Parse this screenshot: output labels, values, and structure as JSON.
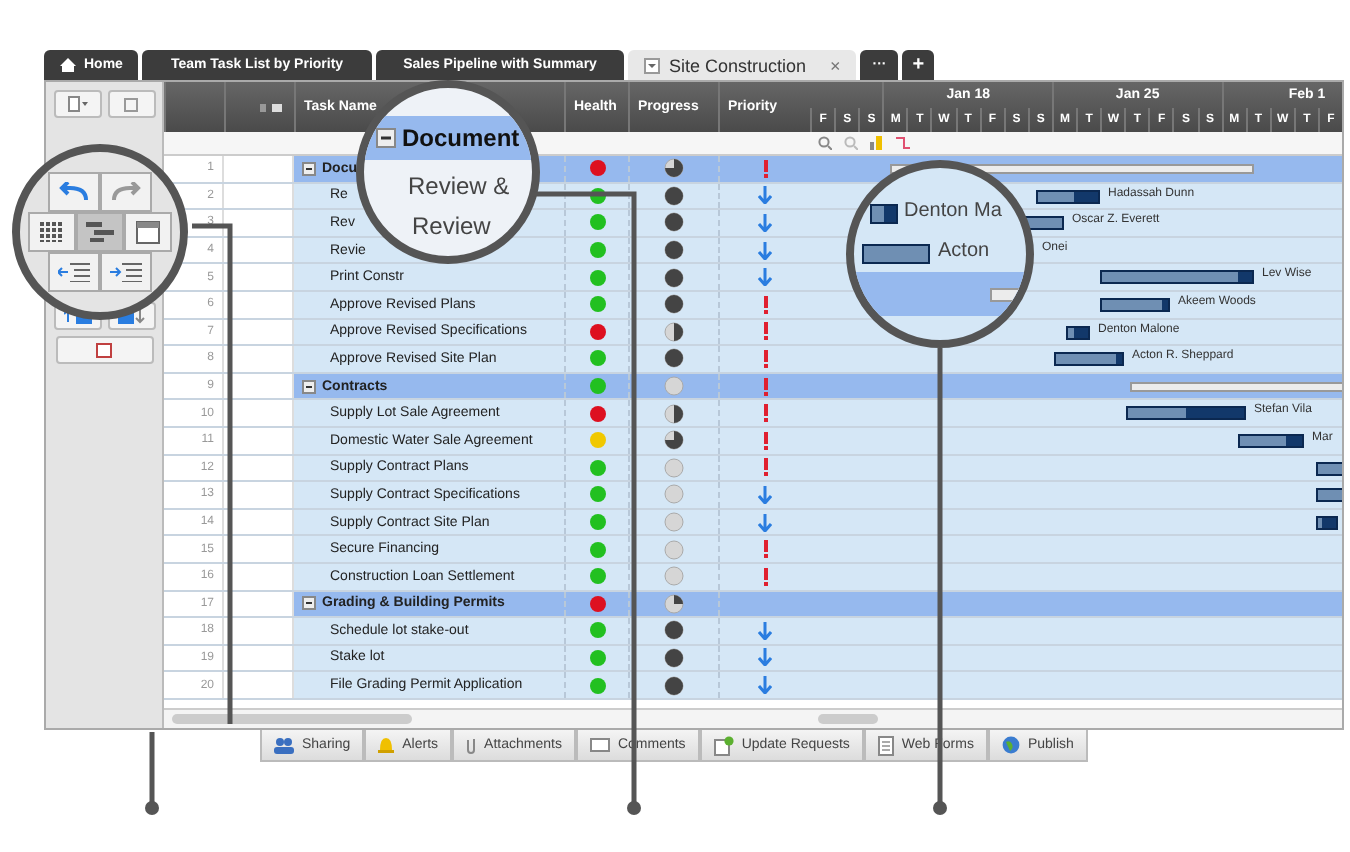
{
  "tabs": [
    {
      "kind": "home",
      "label": "Home",
      "selected": false
    },
    {
      "kind": "sheet",
      "label": "Team Task List by Priority",
      "selected": false
    },
    {
      "kind": "sheet",
      "label": "Sales Pipeline with Summary",
      "selected": false
    },
    {
      "kind": "sheet",
      "label": "Site Construction",
      "selected": true,
      "close": "×"
    },
    {
      "kind": "more",
      "label": "···",
      "selected": false
    },
    {
      "kind": "add",
      "label": "+",
      "selected": false
    }
  ],
  "columns": [
    "Task Name",
    "Health",
    "Progress",
    "Priority"
  ],
  "timeline": {
    "weeks": [
      "Jan 18",
      "Jan 25",
      "Feb 1"
    ],
    "days": [
      "F",
      "S",
      "S",
      "M",
      "T",
      "W",
      "T",
      "F",
      "S",
      "S",
      "M",
      "T",
      "W",
      "T",
      "F",
      "S",
      "S",
      "M",
      "T",
      "W",
      "T",
      "F"
    ]
  },
  "rows": [
    {
      "number": "1",
      "kind": "group",
      "name": "Docu",
      "health": {
        "color": "#dd1020"
      },
      "progress": {
        "kind": "three-quarters"
      },
      "priority": {
        "kind": "high"
      }
    },
    {
      "number": "2",
      "kind": "task",
      "name": "Re",
      "health": {
        "color": "#22c020"
      },
      "progress": {
        "kind": "full"
      },
      "priority": {
        "kind": "low"
      },
      "bar": {
        "level": 0.6,
        "assignee": "Hadassah Dunn"
      }
    },
    {
      "number": "3",
      "kind": "task",
      "name": "Rev",
      "health": {
        "color": "#22c020"
      },
      "progress": {
        "kind": "full"
      },
      "priority": {
        "kind": "low"
      },
      "bar": {
        "level": 1,
        "assignee": "Oscar Z. Everett"
      }
    },
    {
      "number": "4",
      "kind": "task",
      "name": "Revie",
      "health": {
        "color": "#22c020"
      },
      "progress": {
        "kind": "full"
      },
      "priority": {
        "kind": "low"
      },
      "bar": {
        "assignee": "Onei"
      }
    },
    {
      "number": "5",
      "kind": "task",
      "name": "Print Constr",
      "health": {
        "color": "#22c020"
      },
      "progress": {
        "kind": "full"
      },
      "priority": {
        "kind": "low"
      },
      "bar": {
        "level": 0.9,
        "assignee": "Lev Wise"
      }
    },
    {
      "number": "6",
      "kind": "task",
      "name": "Approve Revised Plans",
      "health": {
        "color": "#22c020"
      },
      "progress": {
        "kind": "full"
      },
      "priority": {
        "kind": "high"
      },
      "bar": {
        "level": 0.9,
        "assignee": "Akeem Woods"
      }
    },
    {
      "number": "7",
      "kind": "task",
      "name": "Approve Revised Specifications",
      "health": {
        "color": "#dd1020"
      },
      "progress": {
        "kind": "half"
      },
      "priority": {
        "kind": "high"
      },
      "bar": {
        "level": 0.3,
        "assignee": "Denton Malone"
      }
    },
    {
      "number": "8",
      "kind": "task",
      "name": "Approve Revised Site Plan",
      "health": {
        "color": "#22c020"
      },
      "progress": {
        "kind": "full"
      },
      "priority": {
        "kind": "high"
      },
      "bar": {
        "level": 0.9,
        "assignee": "Acton R. Sheppard"
      }
    },
    {
      "number": "9",
      "kind": "group",
      "name": "Contracts",
      "health": {
        "color": "#22c020"
      },
      "progress": {
        "kind": "empty"
      },
      "priority": {
        "kind": "high"
      }
    },
    {
      "number": "10",
      "kind": "task",
      "name": "Supply Lot Sale Agreement",
      "health": {
        "color": "#dd1020"
      },
      "progress": {
        "kind": "half"
      },
      "priority": {
        "kind": "high"
      },
      "bar": {
        "level": 0.5,
        "assignee": "Stefan Vila"
      }
    },
    {
      "number": "11",
      "kind": "task",
      "name": "Domestic Water Sale Agreement",
      "health": {
        "color": "#f0c800"
      },
      "progress": {
        "kind": "three-quarters"
      },
      "priority": {
        "kind": "high"
      },
      "bar": {
        "level": 0.75,
        "assignee": "Mar"
      }
    },
    {
      "number": "12",
      "kind": "task",
      "name": "Supply Contract Plans",
      "health": {
        "color": "#22c020"
      },
      "progress": {
        "kind": "empty"
      },
      "priority": {
        "kind": "high"
      },
      "bar": {
        "level": 0.9
      }
    },
    {
      "number": "13",
      "kind": "task",
      "name": "Supply Contract Specifications",
      "health": {
        "color": "#22c020"
      },
      "progress": {
        "kind": "empty"
      },
      "priority": {
        "kind": "low"
      },
      "bar": {
        "level": 0.9
      }
    },
    {
      "number": "14",
      "kind": "task",
      "name": "Supply Contract Site Plan",
      "health": {
        "color": "#22c020"
      },
      "progress": {
        "kind": "empty"
      },
      "priority": {
        "kind": "low"
      },
      "bar": {
        "level": 0.2
      }
    },
    {
      "number": "15",
      "kind": "task",
      "name": "Secure Financing",
      "health": {
        "color": "#22c020"
      },
      "progress": {
        "kind": "empty"
      },
      "priority": {
        "kind": "high"
      }
    },
    {
      "number": "16",
      "kind": "task",
      "name": "Construction Loan Settlement",
      "health": {
        "color": "#22c020"
      },
      "progress": {
        "kind": "empty"
      },
      "priority": {
        "kind": "high"
      }
    },
    {
      "number": "17",
      "kind": "group",
      "name": "Grading & Building Permits",
      "health": {
        "color": "#dd1020"
      },
      "progress": {
        "kind": "quarter"
      }
    },
    {
      "number": "18",
      "kind": "task",
      "name": "Schedule lot stake-out",
      "health": {
        "color": "#22c020"
      },
      "progress": {
        "kind": "full"
      },
      "priority": {
        "kind": "low"
      }
    },
    {
      "number": "19",
      "kind": "task",
      "name": "Stake lot",
      "health": {
        "color": "#22c020"
      },
      "progress": {
        "kind": "full"
      },
      "priority": {
        "kind": "low"
      }
    },
    {
      "number": "20",
      "kind": "task",
      "name": "File Grading Permit Application",
      "health": {
        "color": "#22c020"
      },
      "progress": {
        "kind": "full"
      },
      "priority": {
        "kind": "low"
      }
    }
  ],
  "magnifiers": {
    "grid": {
      "group": "Document",
      "rows": [
        "Review &",
        "Review"
      ]
    },
    "gantt": {
      "labels": [
        "Denton Ma",
        "Acton"
      ]
    }
  },
  "bottom_tabs": [
    {
      "kind": "sharing",
      "label": "Sharing"
    },
    {
      "kind": "alerts",
      "label": "Alerts"
    },
    {
      "kind": "attachments",
      "label": "Attachments"
    },
    {
      "kind": "comments",
      "label": "Comments"
    },
    {
      "kind": "requests",
      "label": "Update Requests"
    },
    {
      "kind": "forms",
      "label": "Web Forms"
    },
    {
      "kind": "publish",
      "label": "Publish"
    }
  ]
}
